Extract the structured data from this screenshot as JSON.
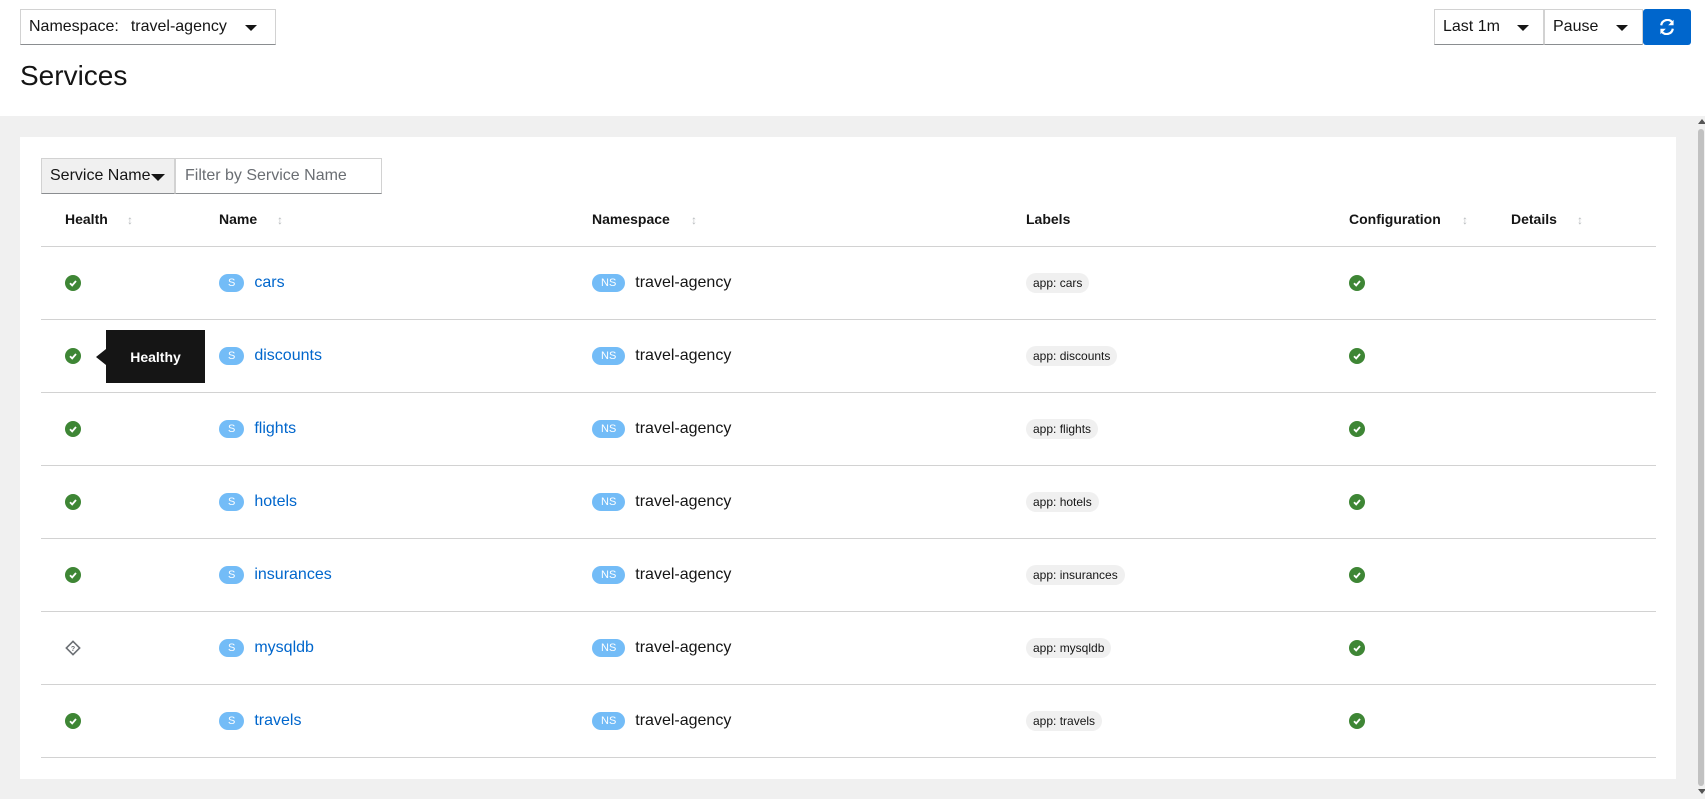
{
  "header": {
    "namespace_label": "Namespace:",
    "namespace_value": "travel-agency",
    "time_range": "Last 1m",
    "refresh_interval": "Pause",
    "refresh_icon": "sync-icon",
    "page_title": "Services"
  },
  "filter": {
    "type_label": "Service Name",
    "placeholder": "Filter by Service Name"
  },
  "columns": {
    "health": "Health",
    "name": "Name",
    "namespace": "Namespace",
    "labels": "Labels",
    "configuration": "Configuration",
    "details": "Details"
  },
  "badges": {
    "service": "S",
    "namespace": "NS"
  },
  "rows": [
    {
      "health": "healthy",
      "name": "cars",
      "namespace": "travel-agency",
      "label": "app: cars",
      "config": "valid"
    },
    {
      "health": "healthy",
      "name": "discounts",
      "namespace": "travel-agency",
      "label": "app: discounts",
      "config": "valid"
    },
    {
      "health": "healthy",
      "name": "flights",
      "namespace": "travel-agency",
      "label": "app: flights",
      "config": "valid"
    },
    {
      "health": "healthy",
      "name": "hotels",
      "namespace": "travel-agency",
      "label": "app: hotels",
      "config": "valid"
    },
    {
      "health": "healthy",
      "name": "insurances",
      "namespace": "travel-agency",
      "label": "app: insurances",
      "config": "valid"
    },
    {
      "health": "unknown",
      "name": "mysqldb",
      "namespace": "travel-agency",
      "label": "app: mysqldb",
      "config": "valid"
    },
    {
      "health": "healthy",
      "name": "travels",
      "namespace": "travel-agency",
      "label": "app: travels",
      "config": "valid"
    }
  ],
  "tooltip": {
    "text": "Healthy"
  },
  "colors": {
    "healthy": "#3e8635",
    "link": "#0066cc",
    "badge": "#73bcf7",
    "primary_button": "#0066cc"
  }
}
